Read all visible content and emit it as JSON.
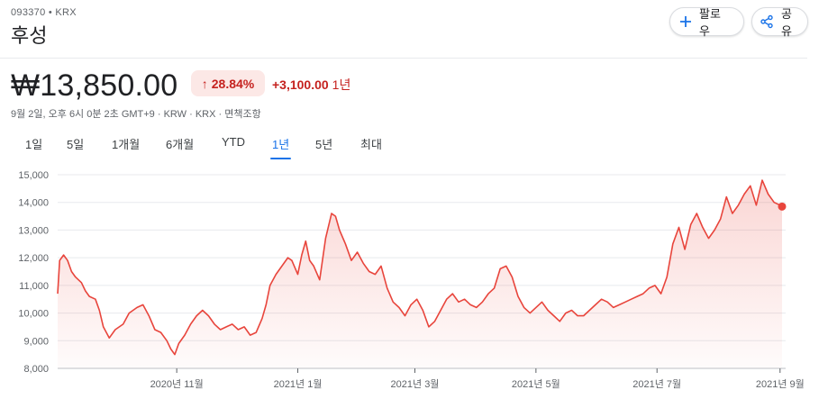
{
  "header": {
    "ticker": "093370 • KRX",
    "name": "후성",
    "follow_label": "팔로우",
    "share_label": "공유"
  },
  "quote": {
    "price": "₩13,850.00",
    "change_pct": "28.84%",
    "change_abs": "+3,100.00",
    "change_period": "1년",
    "meta": "9월 2일, 오후 6시 0분 2초 GMT+9 · KRW · KRX · 면책조항"
  },
  "tabs": [
    "1일",
    "5일",
    "1개월",
    "6개월",
    "YTD",
    "1년",
    "5년",
    "최대"
  ],
  "active_tab": "1년",
  "colors": {
    "line": "#e8453c",
    "fill": "#fde8e6",
    "down": "#c5221f",
    "accent": "#1a73e8"
  },
  "chart_data": {
    "type": "area",
    "title": "",
    "xlabel": "",
    "ylabel": "",
    "ylim": [
      8000,
      15000
    ],
    "yticks": [
      8000,
      9000,
      10000,
      11000,
      12000,
      13000,
      14000,
      15000
    ],
    "ytick_labels": [
      "8,000",
      "9,000",
      "10,000",
      "11,000",
      "12,000",
      "13,000",
      "14,000",
      "15,000"
    ],
    "xlim": [
      "2020-09-02",
      "2021-09-02"
    ],
    "xticks": [
      {
        "date": "2020-11-01",
        "label": "2020년 11월"
      },
      {
        "date": "2021-01-01",
        "label": "2021년 1월"
      },
      {
        "date": "2021-03-01",
        "label": "2021년 3월"
      },
      {
        "date": "2021-05-01",
        "label": "2021년 5월"
      },
      {
        "date": "2021-07-01",
        "label": "2021년 7월"
      },
      {
        "date": "2021-09-01",
        "label": "2021년 9월"
      }
    ],
    "grid": true,
    "series": [
      {
        "x": [
          "2020-09-02",
          "2020-09-03",
          "2020-09-05",
          "2020-09-07",
          "2020-09-09",
          "2020-09-11",
          "2020-09-14",
          "2020-09-16",
          "2020-09-18",
          "2020-09-21",
          "2020-09-23",
          "2020-09-25",
          "2020-09-28",
          "2020-10-01",
          "2020-10-05",
          "2020-10-08",
          "2020-10-12",
          "2020-10-15",
          "2020-10-18",
          "2020-10-21",
          "2020-10-24",
          "2020-10-27",
          "2020-10-29",
          "2020-10-31",
          "2020-11-02",
          "2020-11-05",
          "2020-11-08",
          "2020-11-11",
          "2020-11-14",
          "2020-11-17",
          "2020-11-20",
          "2020-11-23",
          "2020-11-26",
          "2020-11-29",
          "2020-12-02",
          "2020-12-05",
          "2020-12-08",
          "2020-12-11",
          "2020-12-14",
          "2020-12-16",
          "2020-12-18",
          "2020-12-21",
          "2020-12-24",
          "2020-12-27",
          "2020-12-29",
          "2021-01-01",
          "2021-01-03",
          "2021-01-05",
          "2021-01-07",
          "2021-01-09",
          "2021-01-12",
          "2021-01-15",
          "2021-01-18",
          "2021-01-20",
          "2021-01-22",
          "2021-01-25",
          "2021-01-28",
          "2021-01-31",
          "2021-02-03",
          "2021-02-06",
          "2021-02-09",
          "2021-02-12",
          "2021-02-15",
          "2021-02-18",
          "2021-02-21",
          "2021-02-24",
          "2021-02-27",
          "2021-03-02",
          "2021-03-05",
          "2021-03-08",
          "2021-03-11",
          "2021-03-14",
          "2021-03-17",
          "2021-03-20",
          "2021-03-23",
          "2021-03-26",
          "2021-03-29",
          "2021-04-01",
          "2021-04-04",
          "2021-04-07",
          "2021-04-10",
          "2021-04-13",
          "2021-04-16",
          "2021-04-19",
          "2021-04-22",
          "2021-04-25",
          "2021-04-28",
          "2021-05-01",
          "2021-05-04",
          "2021-05-07",
          "2021-05-10",
          "2021-05-13",
          "2021-05-16",
          "2021-05-19",
          "2021-05-22",
          "2021-05-25",
          "2021-05-28",
          "2021-05-31",
          "2021-06-03",
          "2021-06-06",
          "2021-06-09",
          "2021-06-12",
          "2021-06-15",
          "2021-06-18",
          "2021-06-21",
          "2021-06-24",
          "2021-06-27",
          "2021-06-30",
          "2021-07-03",
          "2021-07-06",
          "2021-07-09",
          "2021-07-12",
          "2021-07-15",
          "2021-07-18",
          "2021-07-21",
          "2021-07-24",
          "2021-07-27",
          "2021-07-30",
          "2021-08-02",
          "2021-08-05",
          "2021-08-08",
          "2021-08-11",
          "2021-08-14",
          "2021-08-17",
          "2021-08-20",
          "2021-08-23",
          "2021-08-26",
          "2021-08-29",
          "2021-09-01",
          "2021-09-02"
        ],
        "y": [
          10700,
          11900,
          12100,
          11900,
          11500,
          11300,
          11100,
          10800,
          10600,
          10500,
          10100,
          9500,
          9100,
          9400,
          9600,
          10000,
          10200,
          10300,
          9900,
          9400,
          9300,
          9000,
          8700,
          8500,
          8900,
          9200,
          9600,
          9900,
          10100,
          9900,
          9600,
          9400,
          9500,
          9600,
          9400,
          9500,
          9200,
          9300,
          9800,
          10300,
          11000,
          11400,
          11700,
          12000,
          11900,
          11400,
          12100,
          12600,
          11900,
          11700,
          11200,
          12700,
          13600,
          13500,
          13000,
          12500,
          11900,
          12200,
          11800,
          11500,
          11400,
          11700,
          10900,
          10400,
          10200,
          9900,
          10300,
          10500,
          10100,
          9500,
          9700,
          10100,
          10500,
          10700,
          10400,
          10500,
          10300,
          10200,
          10400,
          10700,
          10900,
          11600,
          11700,
          11300,
          10600,
          10200,
          10000,
          10200,
          10400,
          10100,
          9900,
          9700,
          10000,
          10100,
          9900,
          9900,
          10100,
          10300,
          10500,
          10400,
          10200,
          10300,
          10400,
          10500,
          10600,
          10700,
          10900,
          11000,
          10700,
          11300,
          12500,
          13100,
          12300,
          13200,
          13600,
          13100,
          12700,
          13000,
          13400,
          14200,
          13600,
          13900,
          14300,
          14600,
          13900,
          14800,
          14300,
          14000,
          13900,
          13850
        ]
      }
    ]
  }
}
